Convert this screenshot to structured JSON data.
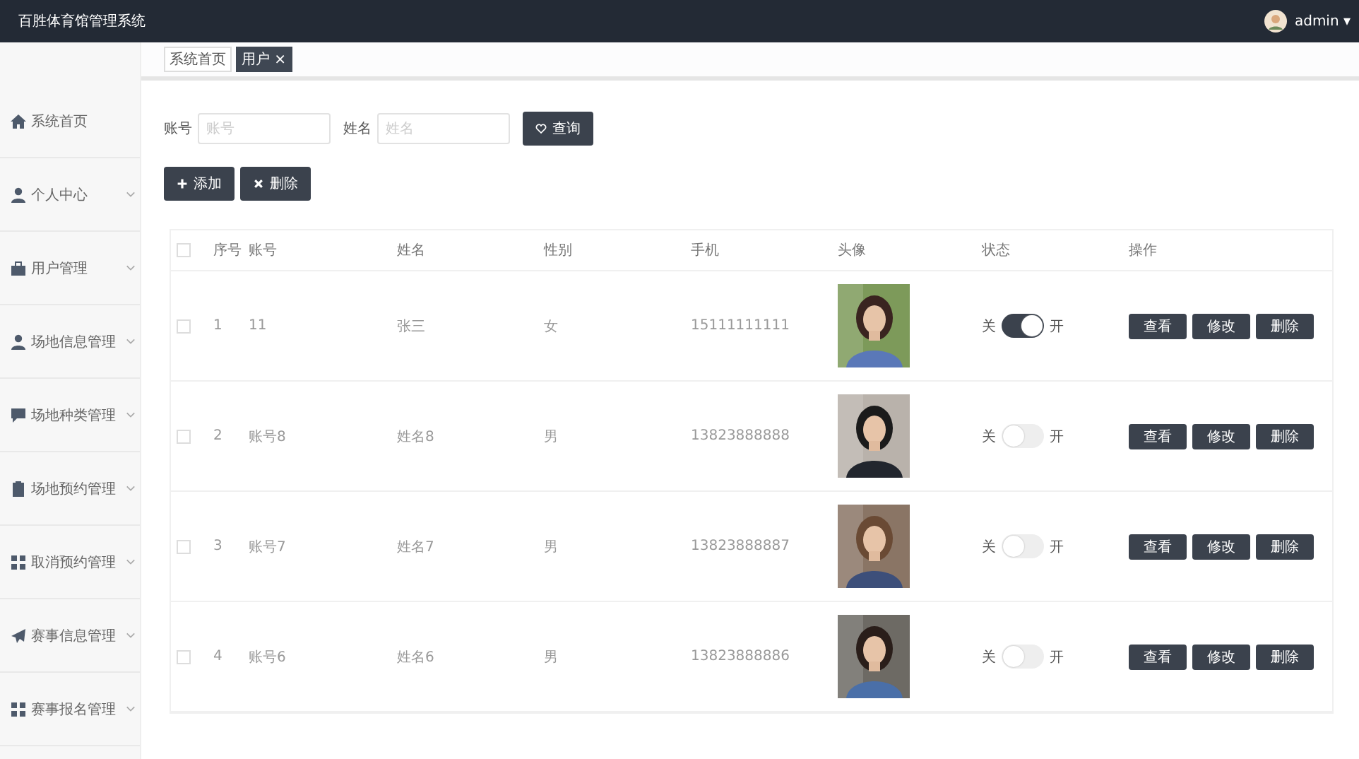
{
  "header": {
    "title": "百胜体育馆管理系统",
    "user": "admin",
    "caret": "▾"
  },
  "sidebar": {
    "items": [
      {
        "label": "系统首页",
        "expandable": false
      },
      {
        "label": "个人中心",
        "expandable": true
      },
      {
        "label": "用户管理",
        "expandable": true
      },
      {
        "label": "场地信息管理",
        "expandable": true
      },
      {
        "label": "场地种类管理",
        "expandable": true
      },
      {
        "label": "场地预约管理",
        "expandable": true
      },
      {
        "label": "取消预约管理",
        "expandable": true
      },
      {
        "label": "赛事信息管理",
        "expandable": true
      },
      {
        "label": "赛事报名管理",
        "expandable": true
      }
    ]
  },
  "tabs": [
    {
      "label": "系统首页",
      "selected": false
    },
    {
      "label": "用户 ×",
      "selected": true
    }
  ],
  "search": {
    "fields": [
      {
        "label": "账号",
        "placeholder": "账号"
      },
      {
        "label": "姓名",
        "placeholder": "姓名"
      }
    ],
    "button": "查询"
  },
  "actions": [
    {
      "label": "添加",
      "kind": "add"
    },
    {
      "label": "删除",
      "kind": "delete"
    }
  ],
  "table": {
    "header_checked": false,
    "columns": [
      "序号",
      "账号",
      "姓名",
      "性别",
      "手机",
      "头像",
      "状态",
      "操作"
    ],
    "rows": [
      {
        "checked": false,
        "index": "1",
        "account": "11",
        "name": "张三",
        "gender": "女",
        "phone": "15111111111",
        "avatar": {
          "kind": "picture"
        },
        "status": {
          "off": "关",
          "on": "开",
          "selected": true
        },
        "buttons": [
          "查看",
          "修改",
          "删除"
        ]
      },
      {
        "checked": false,
        "index": "2",
        "account": "账号8",
        "name": "姓名8",
        "gender": "男",
        "phone": "13823888888",
        "avatar": {
          "kind": "picture"
        },
        "status": {
          "off": "关",
          "on": "开",
          "selected": false
        },
        "buttons": [
          "查看",
          "修改",
          "删除"
        ]
      },
      {
        "checked": false,
        "index": "3",
        "account": "账号7",
        "name": "姓名7",
        "gender": "男",
        "phone": "13823888887",
        "avatar": {
          "kind": "picture"
        },
        "status": {
          "off": "关",
          "on": "开",
          "selected": false
        },
        "buttons": [
          "查看",
          "修改",
          "删除"
        ]
      },
      {
        "checked": false,
        "index": "4",
        "account": "账号6",
        "name": "姓名6",
        "gender": "男",
        "phone": "13823888886",
        "avatar": {
          "kind": "picture"
        },
        "status": {
          "off": "关",
          "on": "开",
          "selected": false
        },
        "buttons": [
          "查看",
          "修改",
          "删除"
        ]
      }
    ]
  }
}
